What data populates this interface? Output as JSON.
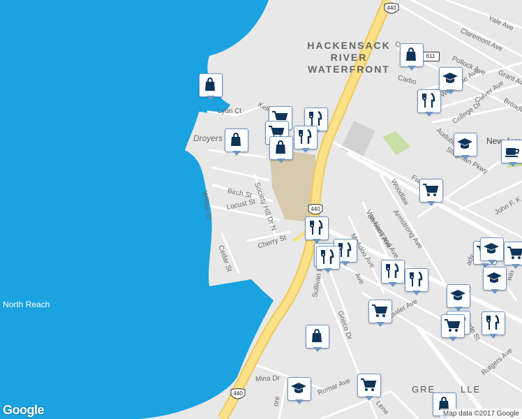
{
  "colors": {
    "water": "#1aa3e0",
    "land": "#e8e8e8",
    "highway": "#fbe289",
    "highway_edge": "#f1c85a",
    "road": "#ffffff",
    "park": "#c8dfa6",
    "landmark": "#d7c9ad",
    "poi_icon": "#0f3459",
    "poi_border": "#6d96c4"
  },
  "labels": {
    "water": "North Reach",
    "area": [
      "HACKENSACK",
      "RIVER",
      "WATERFRONT"
    ],
    "place": "Droyers",
    "city": "New Jersey City",
    "streets": [
      "Lyon Ct",
      "Kello",
      "Willow St",
      "Birch St",
      "Locust St",
      "Society Hill Dr N",
      "Cedar St",
      "Cherry St",
      "Culver Ave",
      "Claremont Ave",
      "Yale Ave",
      "Pollock Ave",
      "Grant Av",
      "West Side Ave",
      "College Dr",
      "Culver Ave",
      "Broadw",
      "Carbo",
      "Audubo",
      "Stegman Pkwy",
      "Fulton",
      "Woodlaw",
      "Armstrong Ave",
      "Van Nostrand Ave",
      "Stevens Ave",
      "McAdoo Ave",
      "Sullivan Dr",
      "Grieco Dr",
      "Fowler Ave",
      "Ave",
      "John F. K",
      "Rutgers Ave",
      "Mina Dr",
      "Romar Ave",
      "Grenville",
      "Lene",
      "Ave",
      "ore",
      "Ave",
      "ady",
      "ode St",
      "win"
    ]
  },
  "shields": [
    "440",
    "440",
    "440"
  ],
  "county_route": "611",
  "pois": [
    {
      "type": "shopping"
    },
    {
      "type": "shopping"
    },
    {
      "type": "shopping"
    },
    {
      "type": "grocery"
    },
    {
      "type": "restaurant"
    },
    {
      "type": "grocery"
    },
    {
      "type": "restaurant"
    },
    {
      "type": "restaurant"
    },
    {
      "type": "shopping"
    },
    {
      "type": "restaurant"
    },
    {
      "type": "restaurant"
    },
    {
      "type": "school"
    },
    {
      "type": "restaurant"
    },
    {
      "type": "school"
    },
    {
      "type": "cafe"
    },
    {
      "type": "grocery"
    },
    {
      "type": "restaurant"
    },
    {
      "type": "restaurant"
    },
    {
      "type": "restaurant"
    },
    {
      "type": "grocery"
    },
    {
      "type": "grocery"
    },
    {
      "type": "restaurant"
    },
    {
      "type": "grocery"
    },
    {
      "type": "school"
    },
    {
      "type": "shopping"
    },
    {
      "type": "grocery"
    },
    {
      "type": "school"
    },
    {
      "type": "school"
    },
    {
      "type": "grocery"
    },
    {
      "type": "shopping"
    },
    {
      "type": "school"
    },
    {
      "type": "grocery"
    }
  ],
  "branding": {
    "logo": "Google",
    "attribution": "Map data ©2017 Google"
  }
}
